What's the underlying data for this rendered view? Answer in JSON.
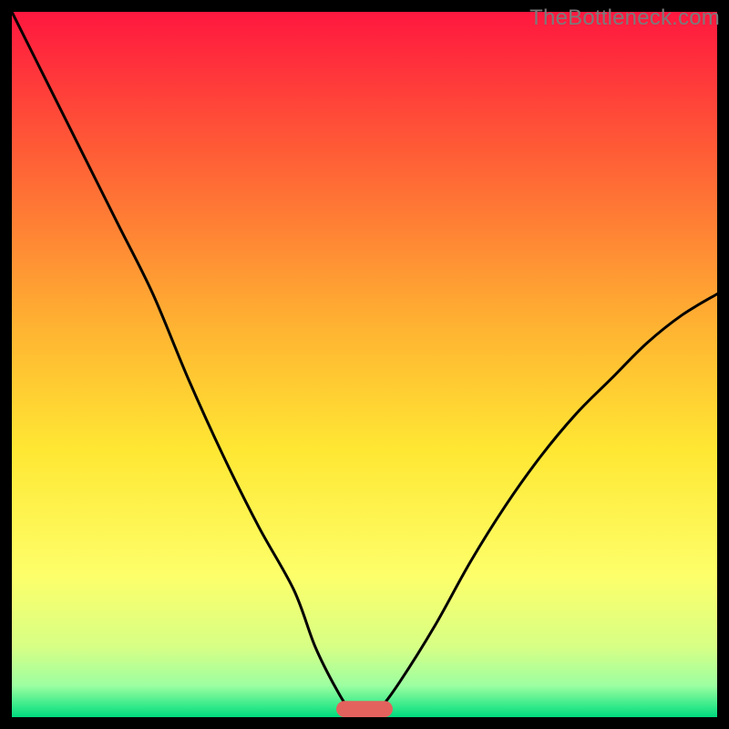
{
  "watermark": "TheBottleneck.com",
  "chart_data": {
    "type": "line",
    "title": "",
    "xlabel": "",
    "ylabel": "",
    "xlim": [
      0,
      100
    ],
    "ylim": [
      0,
      100
    ],
    "x": [
      0,
      5,
      10,
      15,
      20,
      25,
      30,
      35,
      40,
      43,
      46,
      48,
      50,
      52,
      55,
      60,
      65,
      70,
      75,
      80,
      85,
      90,
      95,
      100
    ],
    "values": [
      100,
      90,
      80,
      70,
      60,
      48,
      37,
      27,
      18,
      10,
      4,
      1,
      0,
      1,
      5,
      13,
      22,
      30,
      37,
      43,
      48,
      53,
      57,
      60
    ],
    "gradient_stops": [
      {
        "offset": 0.0,
        "color": "#ff173f"
      },
      {
        "offset": 0.2,
        "color": "#ff5d36"
      },
      {
        "offset": 0.45,
        "color": "#ffb432"
      },
      {
        "offset": 0.62,
        "color": "#ffe733"
      },
      {
        "offset": 0.8,
        "color": "#fdff6a"
      },
      {
        "offset": 0.9,
        "color": "#d7ff85"
      },
      {
        "offset": 0.955,
        "color": "#9dffa1"
      },
      {
        "offset": 0.985,
        "color": "#32e989"
      },
      {
        "offset": 1.0,
        "color": "#00d97f"
      }
    ],
    "marker": {
      "x_center": 50,
      "width": 8,
      "y": 0,
      "height": 2.3,
      "rx": 1.1,
      "fill": "#e4625e"
    },
    "curve_stroke": "#000000",
    "curve_stroke_width": 3
  }
}
